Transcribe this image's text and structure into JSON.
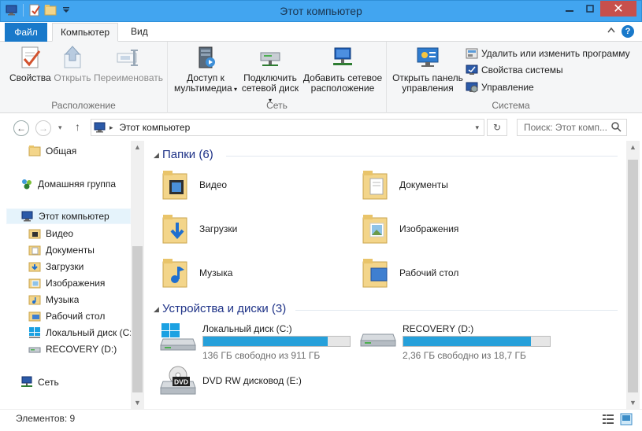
{
  "window": {
    "title": "Этот компьютер"
  },
  "tabs": {
    "file": "Файл",
    "computer": "Компьютер",
    "view": "Вид"
  },
  "ribbon": {
    "location": {
      "label": "Расположение",
      "properties": "Свойства",
      "open": "Открыть",
      "rename": "Переименовать"
    },
    "network": {
      "label": "Сеть",
      "media_l1": "Доступ к",
      "media_l2": "мультимедиа",
      "map_l1": "Подключить",
      "map_l2": "сетевой диск",
      "addloc_l1": "Добавить сетевое",
      "addloc_l2": "расположение"
    },
    "system": {
      "label": "Система",
      "cpanel_l1": "Открыть панель",
      "cpanel_l2": "управления",
      "uninstall": "Удалить или изменить программу",
      "sysprops": "Свойства системы",
      "manage": "Управление"
    }
  },
  "address": {
    "path": "Этот компьютер",
    "search_placeholder": "Поиск: Этот комп..."
  },
  "nav": {
    "shared": "Общая",
    "homegroup": "Домашняя группа",
    "thispc": "Этот компьютер",
    "video": "Видео",
    "docs": "Документы",
    "downloads": "Загрузки",
    "images": "Изображения",
    "music": "Музыка",
    "desktop": "Рабочий стол",
    "localdisk": "Локальный диск (C:",
    "recovery": "RECOVERY (D:)",
    "network": "Сеть"
  },
  "folders": {
    "header": "Папки (6)",
    "video": "Видео",
    "docs": "Документы",
    "downloads": "Загрузки",
    "images": "Изображения",
    "music": "Музыка",
    "desktop": "Рабочий стол"
  },
  "devices": {
    "header": "Устройства и диски (3)",
    "c": {
      "name": "Локальный диск (C:)",
      "free": "136 ГБ свободно из 911 ГБ",
      "used_fraction": 0.85
    },
    "d": {
      "name": "RECOVERY (D:)",
      "free": "2,36 ГБ свободно из 18,7 ГБ",
      "used_fraction": 0.87
    },
    "dvd": {
      "name": "DVD RW дисковод (E:)",
      "badge": "DVD"
    }
  },
  "status": {
    "count": "Элементов: 9"
  },
  "colors": {
    "accent": "#1979ca",
    "titlebar": "#42a5f0",
    "bar_fill": "#26a0da",
    "section": "#1e3287"
  }
}
